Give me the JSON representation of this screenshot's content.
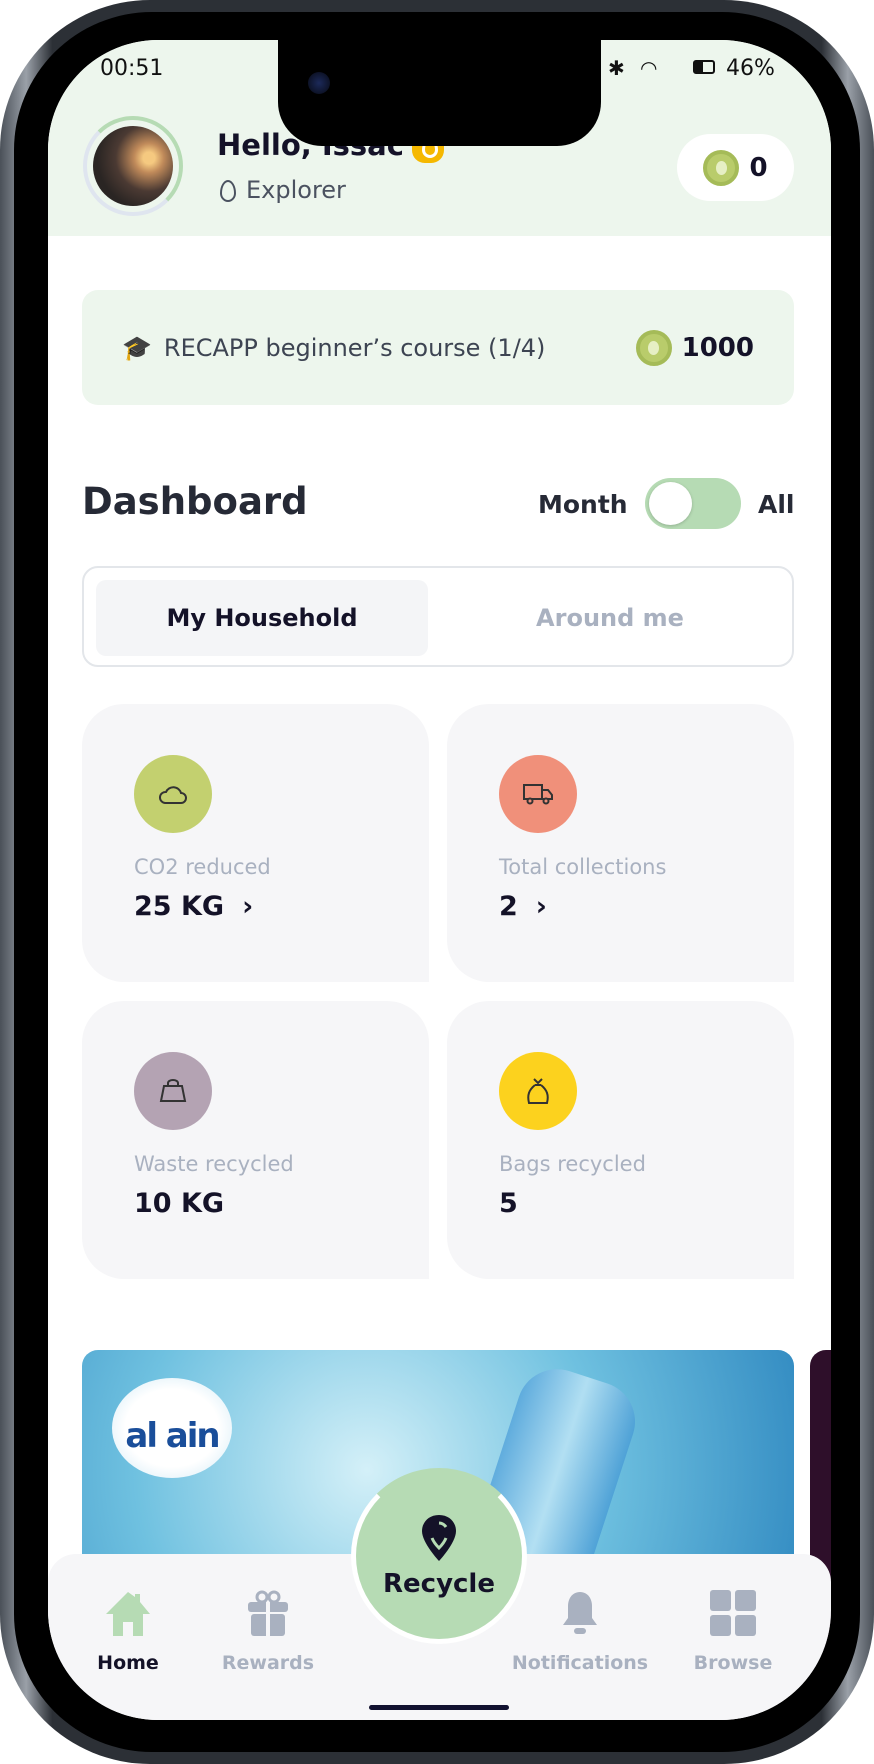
{
  "status": {
    "time": "00:51",
    "battery": "46%"
  },
  "header": {
    "greeting": "Hello, Issac",
    "level": "Explorer",
    "coins": "0"
  },
  "course": {
    "title": "RECAPP beginner’s course (1/4)",
    "points": "1000"
  },
  "dashboard": {
    "title": "Dashboard",
    "toggle_left": "Month",
    "toggle_right": "All",
    "toggle_state": "Month",
    "tabs": [
      {
        "label": "My Household",
        "selected": true
      },
      {
        "label": "Around me",
        "selected": false
      }
    ],
    "stats": [
      {
        "label": "CO2 reduced",
        "value": "25 KG",
        "icon": "cloud-icon",
        "color": "#c3d06f",
        "chevron": true
      },
      {
        "label": "Total collections",
        "value": "2",
        "icon": "truck-icon",
        "color": "#f0907a",
        "chevron": true
      },
      {
        "label": "Waste recycled",
        "value": "10 KG",
        "icon": "weight-icon",
        "color": "#b4a3b3",
        "chevron": false
      },
      {
        "label": "Bags recycled",
        "value": "5",
        "icon": "bag-icon",
        "color": "#fcd21e",
        "chevron": false
      }
    ]
  },
  "banner": {
    "brand": "al ain"
  },
  "nav": {
    "items": [
      {
        "label": "Home",
        "active": true
      },
      {
        "label": "Rewards"
      },
      {
        "label": "Notifications"
      },
      {
        "label": "Browse"
      }
    ],
    "center": "Recycle"
  },
  "colors": {
    "accent": "#b6dbb4",
    "header_bg": "#edf6ed",
    "inactive": "#a9b1c0"
  }
}
